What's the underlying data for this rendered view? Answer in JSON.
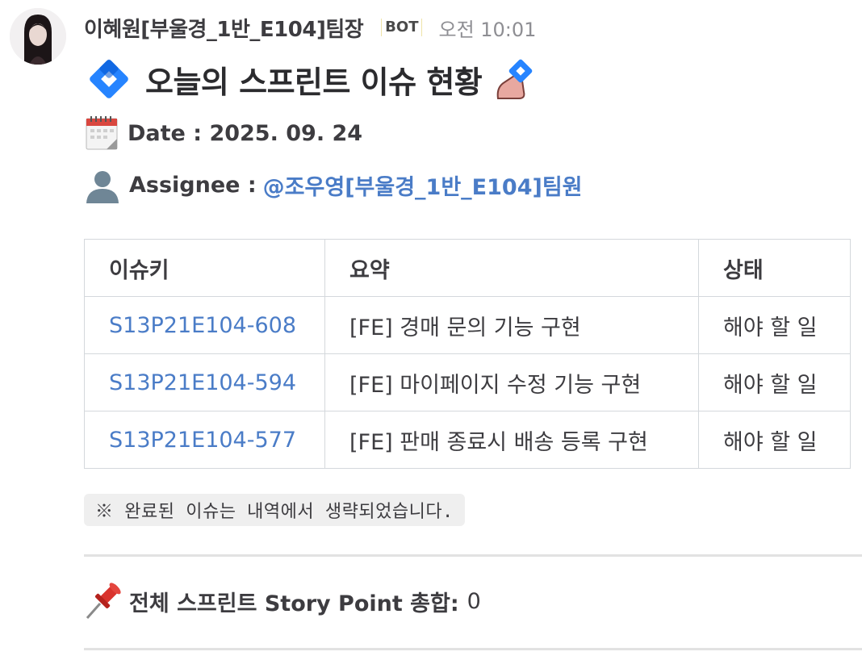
{
  "sender": {
    "name": "이혜원[부울경_1반_E104]팀장",
    "badge": "BOT",
    "time": "오전 10:01"
  },
  "message": {
    "title": "오늘의 스프린트 이슈 현황",
    "date_line": "Date : 2025. 09. 24",
    "assignee_label": "Assignee :",
    "assignee_mention": "@조우영[부울경_1반_E104]팀원",
    "table": {
      "headers": [
        "이슈키",
        "요약",
        "상태"
      ],
      "rows": [
        {
          "key": "S13P21E104-608",
          "summary": "[FE] 경매 문의 기능 구현",
          "status": "해야 할 일"
        },
        {
          "key": "S13P21E104-594",
          "summary": "[FE] 마이페이지 수정 기능 구현",
          "status": "해야 할 일"
        },
        {
          "key": "S13P21E104-577",
          "summary": "[FE] 판매 종료시 배송 등록 구현",
          "status": "해야 할 일"
        }
      ]
    },
    "note": "※ 완료된 이슈는 내역에서 생략되었습니다.",
    "story_point_label": "전체 스프린트 Story Point 총합:",
    "story_point_value": "0"
  },
  "icons": {
    "title_left": "jira-diamond-icon",
    "title_right": "hand-holding-jira-icon",
    "date": "calendar-icon",
    "assignee": "user-silhouette-icon",
    "story_point": "pushpin-icon"
  },
  "colors": {
    "link": "#4a7cc7",
    "jira_blue": "#2684ff",
    "note_bg": "#efefef"
  }
}
